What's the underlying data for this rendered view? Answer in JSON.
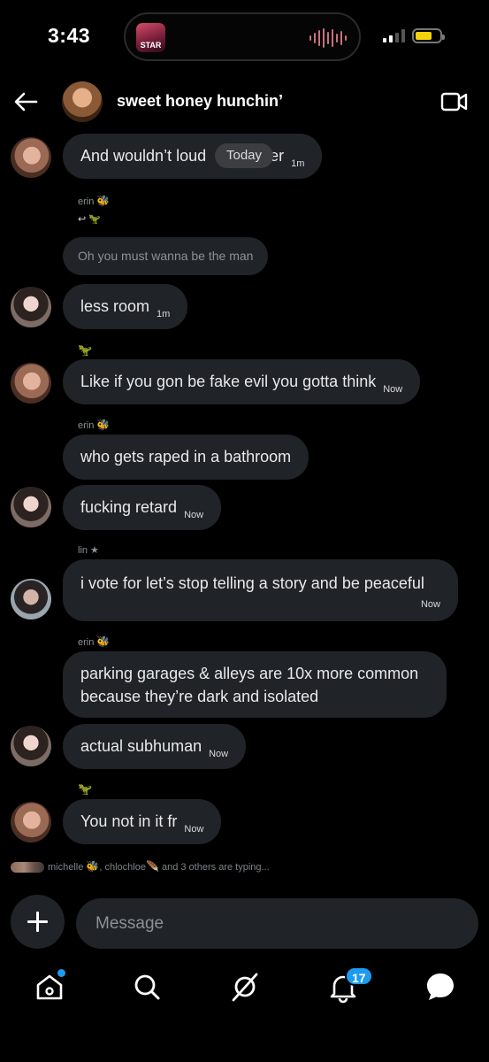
{
  "status_bar": {
    "time": "3:43",
    "island_app_label": "STAR",
    "signal_icon": "cellular-signal-icon",
    "battery_icon": "battery-icon",
    "battery_color": "#f5d20a"
  },
  "header": {
    "title": "sweet honey hunchin’",
    "back_icon": "back-arrow-icon",
    "video_icon": "video-call-icon"
  },
  "date_divider": "Today",
  "messages": [
    {
      "text": "And wouldn’t loud",
      "tail": "er",
      "time": "1m"
    },
    {
      "sender": "erin",
      "sender_emoji": "🐝",
      "reply_marker": "↩ 🦖",
      "reply_text": "Oh you must wanna be the man"
    },
    {
      "text": "less room",
      "time": "1m"
    },
    {
      "sender_emoji": "🦖",
      "text": "Like if you gon be fake evil you gotta think",
      "time": "Now"
    },
    {
      "sender": "erin",
      "sender_emoji": "🐝",
      "text": "who gets raped in a bathroom"
    },
    {
      "text": "fucking retard",
      "time": "Now"
    },
    {
      "sender": "lin ★",
      "text": "i vote for let’s stop telling a story and be peaceful",
      "time": "Now"
    },
    {
      "sender": "erin",
      "sender_emoji": "🐝",
      "text": "parking garages & alleys are 10x more common because they’re dark and isolated"
    },
    {
      "text": "actual subhuman",
      "time": "Now"
    },
    {
      "sender_emoji": "🦖",
      "text": "You not in it fr",
      "time": "Now"
    }
  ],
  "typing_indicator": {
    "michelle": "michelle",
    "michelle_emoji": "🐝",
    "chlochloe": ", chlochloe",
    "chlochloe_emoji": "🪶",
    "others": " and 3 others are typing..."
  },
  "composer": {
    "add_icon": "plus-icon",
    "placeholder": "Message"
  },
  "tabbar": {
    "tabs": [
      {
        "name": "home-icon",
        "dot": true
      },
      {
        "name": "search-icon"
      },
      {
        "name": "grok-icon"
      },
      {
        "name": "notifications-icon",
        "badge": "17"
      },
      {
        "name": "messages-icon"
      }
    ],
    "accent_color": "#1d9bf0"
  }
}
